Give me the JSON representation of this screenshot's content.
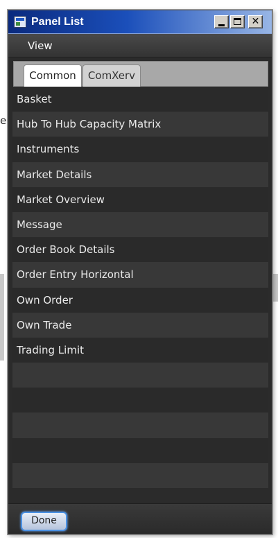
{
  "window": {
    "title": "Panel List"
  },
  "menu": {
    "view_label": "View"
  },
  "tabs": [
    {
      "label": "Common",
      "selected": true
    },
    {
      "label": "ComXerv",
      "selected": false
    }
  ],
  "panels": [
    "Basket",
    "Hub To Hub Capacity Matrix",
    "Instruments",
    "Market Details",
    "Market Overview",
    "Message",
    "Order Book Details",
    "Order Entry Horizontal",
    "Own Order",
    "Own Trade",
    "Trading Limit"
  ],
  "empty_rows": 5,
  "footer": {
    "done_label": "Done"
  },
  "background": {
    "glyph": "e"
  },
  "colors": {
    "title_gradient_start": "#0a2a7e",
    "title_gradient_end": "#98b6e6",
    "list_row_dark": "#2a2a2a",
    "list_row_light": "#383838",
    "done_border": "#4a90e2"
  }
}
